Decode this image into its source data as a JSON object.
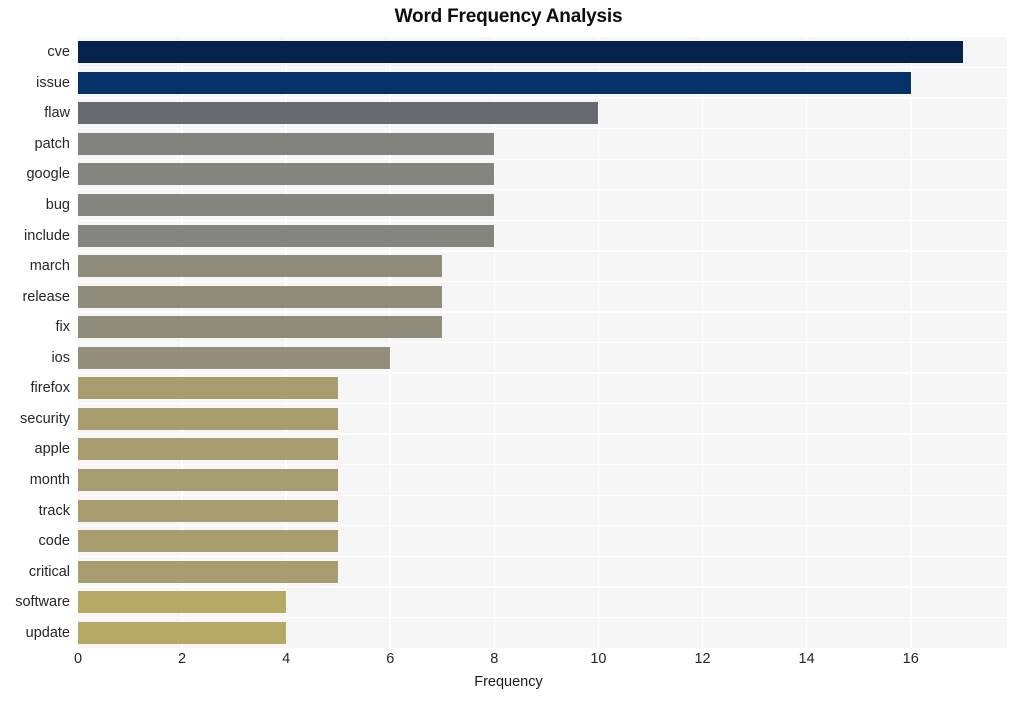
{
  "chart_data": {
    "type": "bar",
    "orientation": "horizontal",
    "title": "Word Frequency Analysis",
    "xlabel": "Frequency",
    "ylabel": "",
    "categories": [
      "cve",
      "issue",
      "flaw",
      "patch",
      "google",
      "bug",
      "include",
      "march",
      "release",
      "fix",
      "ios",
      "firefox",
      "security",
      "apple",
      "month",
      "track",
      "code",
      "critical",
      "software",
      "update"
    ],
    "values": [
      17,
      16,
      10,
      8,
      8,
      8,
      8,
      7,
      7,
      7,
      6,
      5,
      5,
      5,
      5,
      5,
      5,
      5,
      4,
      4
    ],
    "bar_colors": [
      "#05234c",
      "#043268",
      "#686a71",
      "#83837e",
      "#85857f",
      "#85857f",
      "#85857f",
      "#908c7c",
      "#908c7c",
      "#908c7c",
      "#948f7c",
      "#a79d6f",
      "#a79d6f",
      "#a79d6f",
      "#a79d6f",
      "#a79d6f",
      "#a79d6f",
      "#a79d6f",
      "#b6a965",
      "#b6a965"
    ],
    "xlim": [
      0,
      17.85
    ],
    "xticks": [
      0,
      2,
      4,
      6,
      8,
      10,
      12,
      14,
      16
    ],
    "xticklabels": [
      "0",
      "2",
      "4",
      "6",
      "8",
      "10",
      "12",
      "14",
      "16"
    ],
    "grid": true,
    "grid_color": "#ffffff",
    "plot_background": "#f6f6f7",
    "figure_background": "#ffffff",
    "legend": null
  }
}
